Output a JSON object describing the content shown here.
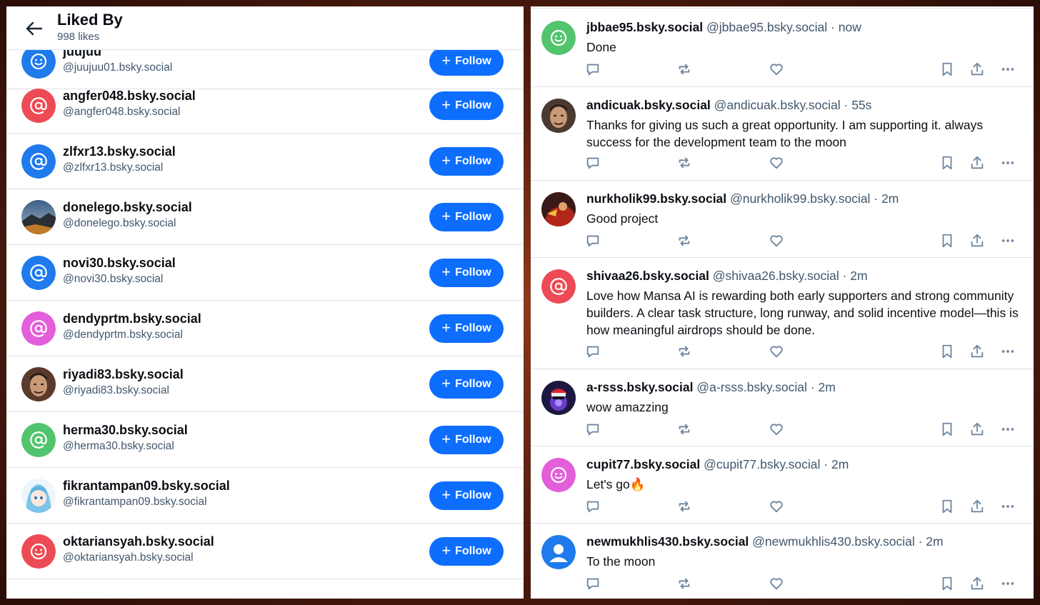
{
  "liked_by": {
    "title": "Liked By",
    "subtitle": "998 likes",
    "follow_label": "Follow",
    "users": [
      {
        "name": "juujuu",
        "handle": "@juujuu01.bsky.social",
        "avatar": "smiley-default-avatar",
        "color": "#1f7aec"
      },
      {
        "name": "angfer048.bsky.social",
        "handle": "@angfer048.bsky.social",
        "avatar": "at-sign-default-avatar",
        "color": "#ec4b55"
      },
      {
        "name": "zlfxr13.bsky.social",
        "handle": "@zlfxr13.bsky.social",
        "avatar": "at-sign-default-avatar",
        "color": "#1f7aec"
      },
      {
        "name": "donelego.bsky.social",
        "handle": "@donelego.bsky.social",
        "avatar": "landscape-photo-avatar",
        "color": "#2e4a6e"
      },
      {
        "name": "novi30.bsky.social",
        "handle": "@novi30.bsky.social",
        "avatar": "at-sign-default-avatar",
        "color": "#1f7aec"
      },
      {
        "name": "dendyprtm.bsky.social",
        "handle": "@dendyprtm.bsky.social",
        "avatar": "at-sign-default-avatar",
        "color": "#e35ed9"
      },
      {
        "name": "riyadi83.bsky.social",
        "handle": "@riyadi83.bsky.social",
        "avatar": "face-photo-avatar",
        "color": "#5a3a2a"
      },
      {
        "name": "herma30.bsky.social",
        "handle": "@herma30.bsky.social",
        "avatar": "at-sign-default-avatar",
        "color": "#52c46d"
      },
      {
        "name": "fikrantampan09.bsky.social",
        "handle": "@fikrantampan09.bsky.social",
        "avatar": "anime-character-avatar",
        "color": "#cfe8f5"
      },
      {
        "name": "oktariansyah.bsky.social",
        "handle": "@oktariansyah.bsky.social",
        "avatar": "smiley-default-avatar",
        "color": "#ec4b55"
      }
    ]
  },
  "feed": {
    "posts": [
      {
        "author": "jbbae95.bsky.social",
        "meta": "@jbbae95.bsky.social · now",
        "text": "Done",
        "avatar": "smiley-default-avatar",
        "color": "#52c46d"
      },
      {
        "author": "andicuak.bsky.social",
        "meta": "@andicuak.bsky.social · 55s",
        "text": "Thanks for giving us such a great opportunity. I am supporting it. always success for the development team to the moon",
        "avatar": "face-photo-avatar",
        "color": "#4a3a30"
      },
      {
        "author": "nurkholik99.bsky.social",
        "meta": "@nurkholik99.bsky.social · 2m",
        "text": "Good project",
        "avatar": "photo-avatar",
        "color": "#8a2a1a"
      },
      {
        "author": "shivaa26.bsky.social",
        "meta": "@shivaa26.bsky.social · 2m",
        "text": "Love how Mansa AI is rewarding both early supporters and strong community builders. A clear task structure, long runway, and solid incentive model—this is how meaningful airdrops should be done.",
        "avatar": "at-sign-default-avatar",
        "color": "#ec4b55"
      },
      {
        "author": "a-rsss.bsky.social",
        "meta": "@a-rsss.bsky.social · 2m",
        "text": "wow amazzing",
        "avatar": "character-photo-avatar",
        "color": "#2a2050"
      },
      {
        "author": "cupit77.bsky.social",
        "meta": "@cupit77.bsky.social · 2m",
        "text": "Let's go🔥",
        "avatar": "heart-eyes-default-avatar",
        "color": "#e35ed9"
      },
      {
        "author": "newmukhlis430.bsky.social",
        "meta": "@newmukhlis430.bsky.social · 2m",
        "text": "To the moon",
        "avatar": "person-default-avatar",
        "color": "#1f7aec"
      }
    ],
    "actions": [
      "reply-icon",
      "repost-icon",
      "like-icon",
      "bookmark-icon",
      "share-icon",
      "more-icon"
    ]
  }
}
